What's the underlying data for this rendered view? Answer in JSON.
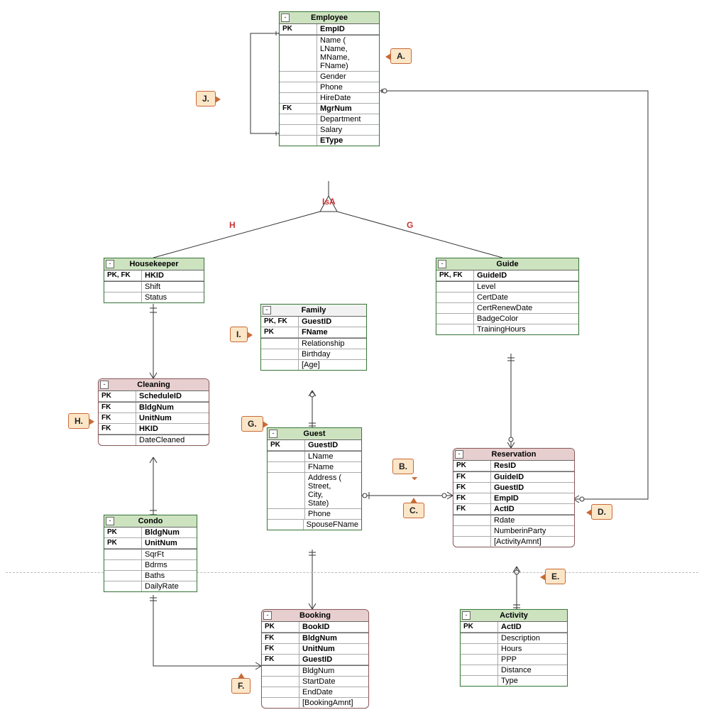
{
  "isa_label": "IsA",
  "branch_labels": {
    "h": "H",
    "g": "G"
  },
  "callouts": {
    "A": "A.",
    "B": "B.",
    "C": "C.",
    "D": "D.",
    "E": "E.",
    "F": "F.",
    "G": "G.",
    "H": "H.",
    "I": "I.",
    "J": "J."
  },
  "entities": {
    "employee": {
      "title": "Employee",
      "rows": [
        {
          "k": "PK",
          "v": "EmpID",
          "bold": true,
          "sep": false
        },
        {
          "k": "",
          "v": "Name ( LName, MName, FName)",
          "sep": true
        },
        {
          "k": "",
          "v": "Gender"
        },
        {
          "k": "",
          "v": "Phone"
        },
        {
          "k": "",
          "v": "HireDate"
        },
        {
          "k": "FK",
          "v": "MgrNum",
          "bold": true
        },
        {
          "k": "",
          "v": "Department"
        },
        {
          "k": "",
          "v": "Salary"
        },
        {
          "k": "",
          "v": "EType",
          "bold": true
        }
      ]
    },
    "housekeeper": {
      "title": "Housekeeper",
      "rows": [
        {
          "k": "PK, FK",
          "v": "HKID",
          "bold": true
        },
        {
          "k": "",
          "v": "Shift",
          "sep": true
        },
        {
          "k": "",
          "v": "Status"
        }
      ]
    },
    "guide": {
      "title": "Guide",
      "rows": [
        {
          "k": "PK, FK",
          "v": "GuideID",
          "bold": true
        },
        {
          "k": "",
          "v": "Level",
          "sep": true
        },
        {
          "k": "",
          "v": "CertDate"
        },
        {
          "k": "",
          "v": "CertRenewDate"
        },
        {
          "k": "",
          "v": "BadgeColor"
        },
        {
          "k": "",
          "v": "TrainingHours"
        }
      ]
    },
    "family": {
      "title": "Family",
      "rows": [
        {
          "k": "PK, FK",
          "v": "GuestID",
          "bold": true
        },
        {
          "k": "PK",
          "v": "FName",
          "bold": true
        },
        {
          "k": "",
          "v": "Relationship",
          "sep": true
        },
        {
          "k": "",
          "v": "Birthday"
        },
        {
          "k": "",
          "v": "[Age]"
        }
      ]
    },
    "cleaning": {
      "title": "Cleaning",
      "rows": [
        {
          "k": "PK",
          "v": "ScheduleID",
          "bold": true
        },
        {
          "k": "FK",
          "v": "BldgNum",
          "bold": true,
          "sep": true
        },
        {
          "k": "FK",
          "v": "UnitNum",
          "bold": true
        },
        {
          "k": "FK",
          "v": "HKID",
          "bold": true
        },
        {
          "k": "",
          "v": "DateCleaned",
          "sep": true
        }
      ]
    },
    "guest": {
      "title": "Guest",
      "rows": [
        {
          "k": "PK",
          "v": "GuestID",
          "bold": true
        },
        {
          "k": "",
          "v": "LName",
          "sep": true
        },
        {
          "k": "",
          "v": "FName"
        },
        {
          "k": "",
          "v": "Address ( Street, City, State)"
        },
        {
          "k": "",
          "v": "Phone"
        },
        {
          "k": "",
          "v": "SpouseFName"
        }
      ]
    },
    "reservation": {
      "title": "Reservation",
      "rows": [
        {
          "k": "PK",
          "v": "ResID",
          "bold": true
        },
        {
          "k": "FK",
          "v": "GuideID",
          "bold": true,
          "sep": true
        },
        {
          "k": "FK",
          "v": "GuestID",
          "bold": true
        },
        {
          "k": "FK",
          "v": "EmpID",
          "bold": true
        },
        {
          "k": "FK",
          "v": "ActID",
          "bold": true
        },
        {
          "k": "",
          "v": "Rdate",
          "sep": true
        },
        {
          "k": "",
          "v": "NumberinParty"
        },
        {
          "k": "",
          "v": "[ActivityAmnt]"
        }
      ]
    },
    "condo": {
      "title": "Condo",
      "rows": [
        {
          "k": "PK",
          "v": "BldgNum",
          "bold": true
        },
        {
          "k": "PK",
          "v": "UnitNum",
          "bold": true
        },
        {
          "k": "",
          "v": "SqrFt",
          "sep": true
        },
        {
          "k": "",
          "v": "Bdrms"
        },
        {
          "k": "",
          "v": "Baths"
        },
        {
          "k": "",
          "v": "DailyRate"
        }
      ]
    },
    "booking": {
      "title": "Booking",
      "rows": [
        {
          "k": "PK",
          "v": "BookID",
          "bold": true
        },
        {
          "k": "FK",
          "v": "BldgNum",
          "bold": true,
          "sep": true
        },
        {
          "k": "FK",
          "v": "UnitNum",
          "bold": true
        },
        {
          "k": "FK",
          "v": "GuestID",
          "bold": true
        },
        {
          "k": "",
          "v": "BldgNum",
          "sep": true
        },
        {
          "k": "",
          "v": "StartDate"
        },
        {
          "k": "",
          "v": "EndDate"
        },
        {
          "k": "",
          "v": "[BookingAmnt]"
        }
      ]
    },
    "activity": {
      "title": "Activity",
      "rows": [
        {
          "k": "PK",
          "v": "ActID",
          "bold": true
        },
        {
          "k": "",
          "v": "Description",
          "sep": true
        },
        {
          "k": "",
          "v": "Hours"
        },
        {
          "k": "",
          "v": "PPP"
        },
        {
          "k": "",
          "v": "Distance"
        },
        {
          "k": "",
          "v": "Type"
        }
      ]
    }
  }
}
